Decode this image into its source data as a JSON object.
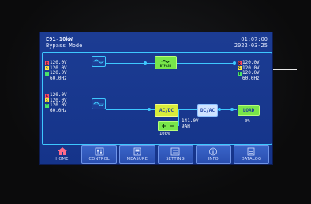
{
  "header": {
    "title": "E91-10kW",
    "mode": "Bypass Mode",
    "time": "01:07:00",
    "date": "2022-03-25"
  },
  "input_bypass": {
    "phases": [
      {
        "tag": "R",
        "value": "120.0V",
        "color": "#ff4c6a"
      },
      {
        "tag": "S",
        "value": "120.0V",
        "color": "#ffe94a"
      },
      {
        "tag": "T",
        "value": "120.0V",
        "color": "#4be36a"
      }
    ],
    "frequency": "60.0Hz"
  },
  "input_main": {
    "phases": [
      {
        "tag": "R",
        "value": "120.0V",
        "color": "#ff4c6a"
      },
      {
        "tag": "S",
        "value": "120.0V",
        "color": "#ffe94a"
      },
      {
        "tag": "T",
        "value": "120.0V",
        "color": "#4be36a"
      }
    ],
    "frequency": "60.0Hz"
  },
  "output": {
    "phases": [
      {
        "tag": "R",
        "value": "120.0V",
        "color": "#ff4c6a"
      },
      {
        "tag": "S",
        "value": "120.0V",
        "color": "#ffe94a"
      },
      {
        "tag": "T",
        "value": "120.0V",
        "color": "#4be36a"
      }
    ],
    "frequency": "60.0Hz"
  },
  "blocks": {
    "bypass_label": "BYPASS",
    "rectifier_label": "AC/DC",
    "inverter_label": "DC/AC",
    "load_label": "LOAD"
  },
  "battery": {
    "voltage": "141.0V",
    "capacity": "9AH",
    "percent": "100%"
  },
  "load": {
    "percent": "0%"
  },
  "nav": [
    {
      "label": "HOME",
      "icon": "home-icon"
    },
    {
      "label": "CONTROL",
      "icon": "control-panel-icon"
    },
    {
      "label": "MEASURE",
      "icon": "meter-icon"
    },
    {
      "label": "SETTING",
      "icon": "settings-icon"
    },
    {
      "label": "INFO",
      "icon": "info-icon"
    },
    {
      "label": "DATALOG",
      "icon": "datalog-icon"
    }
  ],
  "colors": {
    "screen_bg": "#1c3c93",
    "line": "#3ec8ff",
    "active_block": "#78e64a"
  }
}
